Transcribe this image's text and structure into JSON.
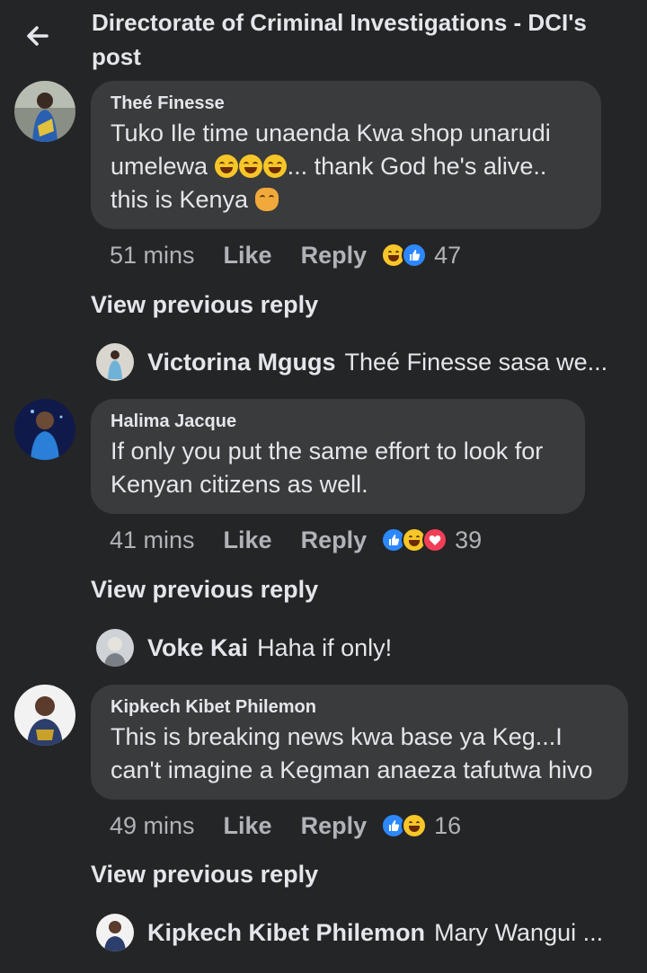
{
  "header": {
    "back_icon": "arrow-left-icon",
    "title": "Directorate of Criminal Investigations - DCI's post"
  },
  "comments": [
    {
      "author": "Theé Finesse",
      "text_before": "Tuko Ile time unaenda Kwa shop unarudi umelewa ",
      "text_after": "... thank God he's alive.. this is Kenya ",
      "time": "51 mins",
      "like_label": "Like",
      "reply_label": "Reply",
      "reactions": [
        "haha",
        "like"
      ],
      "reaction_count": "47",
      "view_previous_label": "View previous reply",
      "reply_preview": {
        "name": "Victorina Mgugs",
        "text": "Theé Finesse sasa we..."
      }
    },
    {
      "author": "Halima Jacque",
      "text": "If only you put the same effort to look for Kenyan citizens as well.",
      "time": "41 mins",
      "like_label": "Like",
      "reply_label": "Reply",
      "reactions": [
        "like",
        "haha",
        "love"
      ],
      "reaction_count": "39",
      "view_previous_label": "View previous reply",
      "reply_preview": {
        "name": "Voke Kai",
        "text": "Haha if only!"
      }
    },
    {
      "author": "Kipkech Kibet Philemon",
      "text": "This is breaking news kwa base ya Keg...I can't imagine a Kegman anaeza tafutwa hivo",
      "time": "49 mins",
      "like_label": "Like",
      "reply_label": "Reply",
      "reactions": [
        "like",
        "haha"
      ],
      "reaction_count": "16",
      "view_previous_label": "View previous reply",
      "reply_preview": {
        "name": "Kipkech Kibet Philemon",
        "text": "Mary Wangui ..."
      }
    }
  ],
  "colors": {
    "background": "#242526",
    "bubble": "#3a3b3c",
    "text": "#e4e6eb",
    "secondary_text": "#b0b3b8",
    "like_blue": "#2d88ff",
    "love_red": "#f33e58",
    "haha_yellow": "#f7c628"
  }
}
